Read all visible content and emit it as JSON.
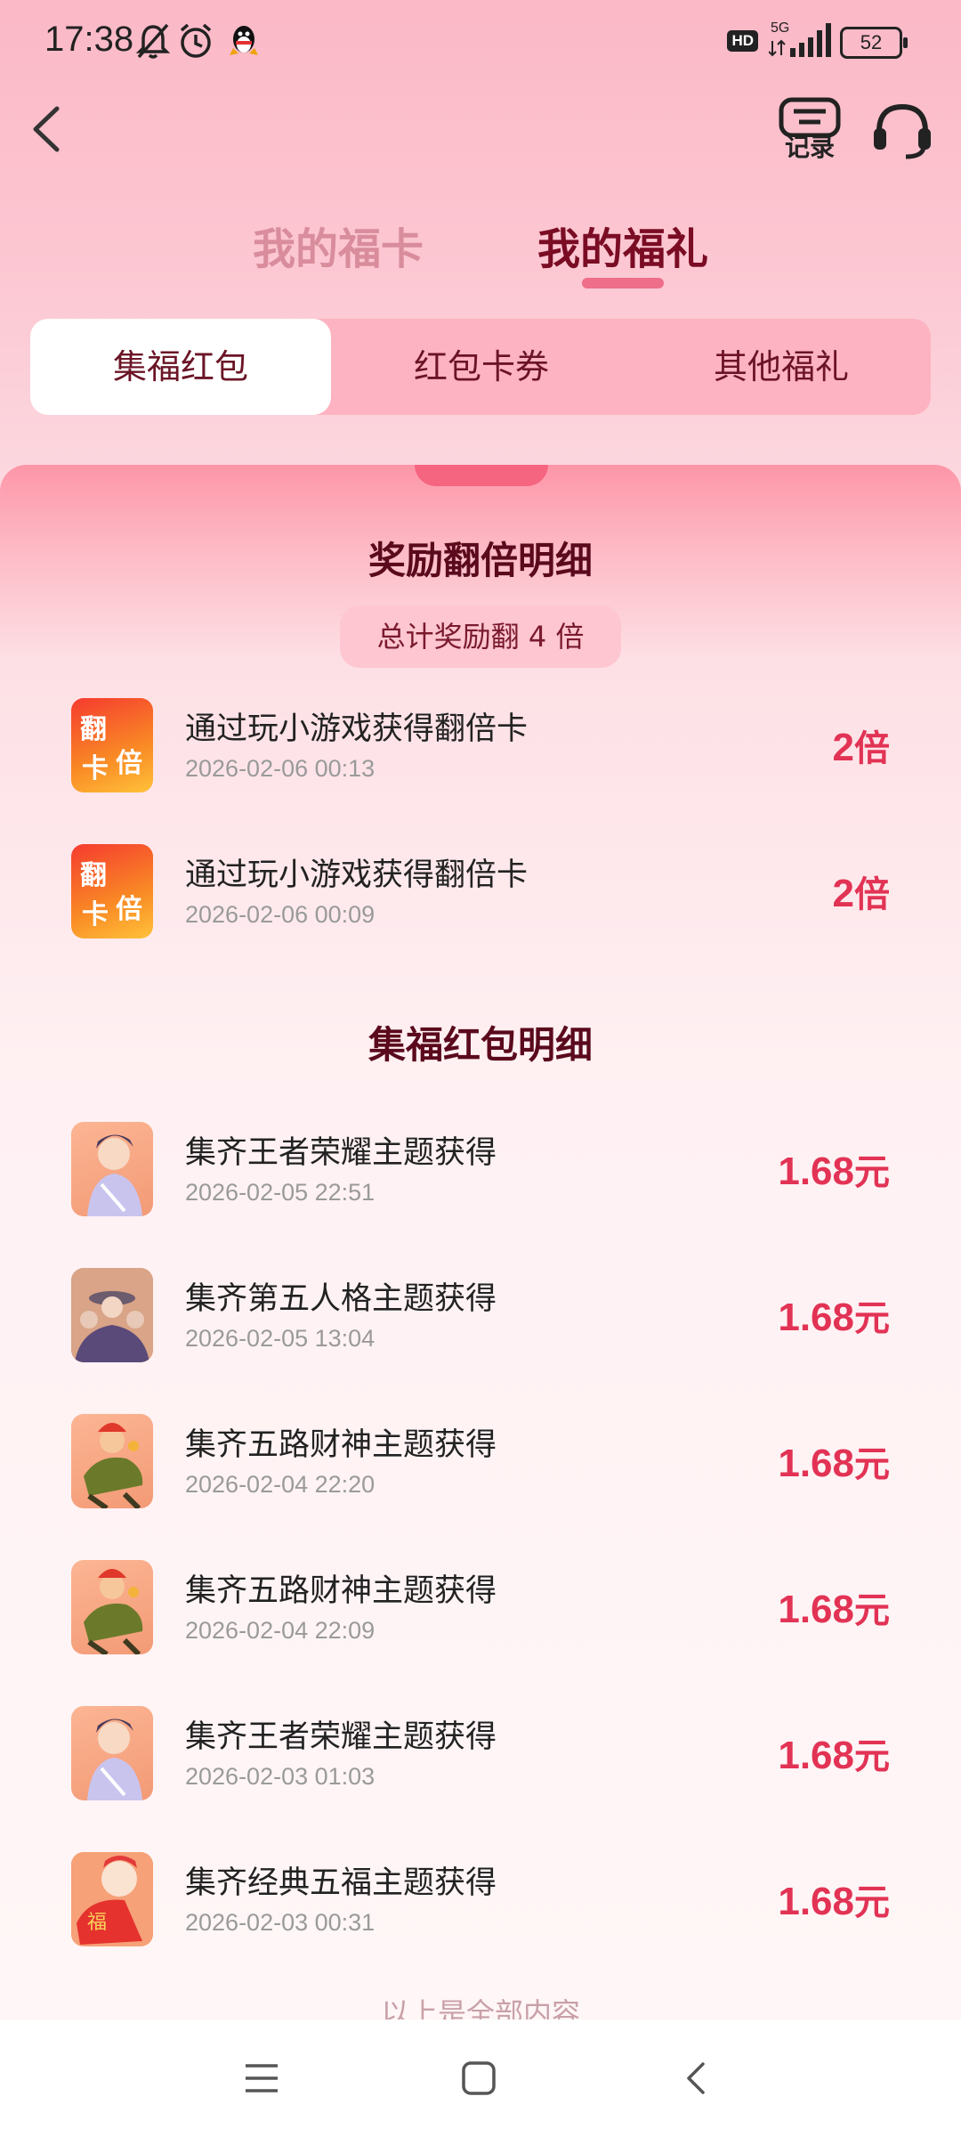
{
  "status": {
    "time": "17:38",
    "network": "5G",
    "hd": "HD",
    "battery": "52"
  },
  "header": {
    "records_label": "记录",
    "icons": [
      "back-arrow-icon",
      "records-icon",
      "customer-service-headset-icon"
    ]
  },
  "main_tabs": [
    {
      "label": "我的福卡",
      "active": false
    },
    {
      "label": "我的福礼",
      "active": true
    }
  ],
  "sub_tabs": [
    {
      "label": "集福红包",
      "active": true
    },
    {
      "label": "红包卡券",
      "active": false
    },
    {
      "label": "其他福礼",
      "active": false
    }
  ],
  "reward_section": {
    "title": "奖励翻倍明细",
    "total": "总计奖励翻 4 倍",
    "items": [
      {
        "name": "通过玩小游戏获得翻倍卡",
        "date": "2026-02-06 00:13",
        "amount": "2",
        "unit": "倍",
        "icon_text": [
          "翻",
          "倍",
          "卡"
        ]
      },
      {
        "name": "通过玩小游戏获得翻倍卡",
        "date": "2026-02-06 00:09",
        "amount": "2",
        "unit": "倍",
        "icon_text": [
          "翻",
          "倍",
          "卡"
        ]
      }
    ]
  },
  "hongbao_section": {
    "title": "集福红包明细",
    "items": [
      {
        "name": "集齐王者荣耀主题获得",
        "date": "2026-02-05 22:51",
        "amount": "1.68",
        "unit": "元",
        "thumb": "game-character-thumb"
      },
      {
        "name": "集齐第五人格主题获得",
        "date": "2026-02-05 13:04",
        "amount": "1.68",
        "unit": "元",
        "thumb": "game-group-thumb"
      },
      {
        "name": "集齐五路财神主题获得",
        "date": "2026-02-04 22:20",
        "amount": "1.68",
        "unit": "元",
        "thumb": "god-of-wealth-thumb"
      },
      {
        "name": "集齐五路财神主题获得",
        "date": "2026-02-04 22:09",
        "amount": "1.68",
        "unit": "元",
        "thumb": "god-of-wealth-thumb"
      },
      {
        "name": "集齐王者荣耀主题获得",
        "date": "2026-02-03 01:03",
        "amount": "1.68",
        "unit": "元",
        "thumb": "game-character-thumb"
      },
      {
        "name": "集齐经典五福主题获得",
        "date": "2026-02-03 00:31",
        "amount": "1.68",
        "unit": "元",
        "thumb": "fu-character-thumb",
        "badge": "福"
      }
    ]
  },
  "end_text": "以上是全部内容",
  "colors": {
    "accent": "#e23355",
    "title": "#5a0a1c",
    "active_tab": "#7a0c24"
  }
}
